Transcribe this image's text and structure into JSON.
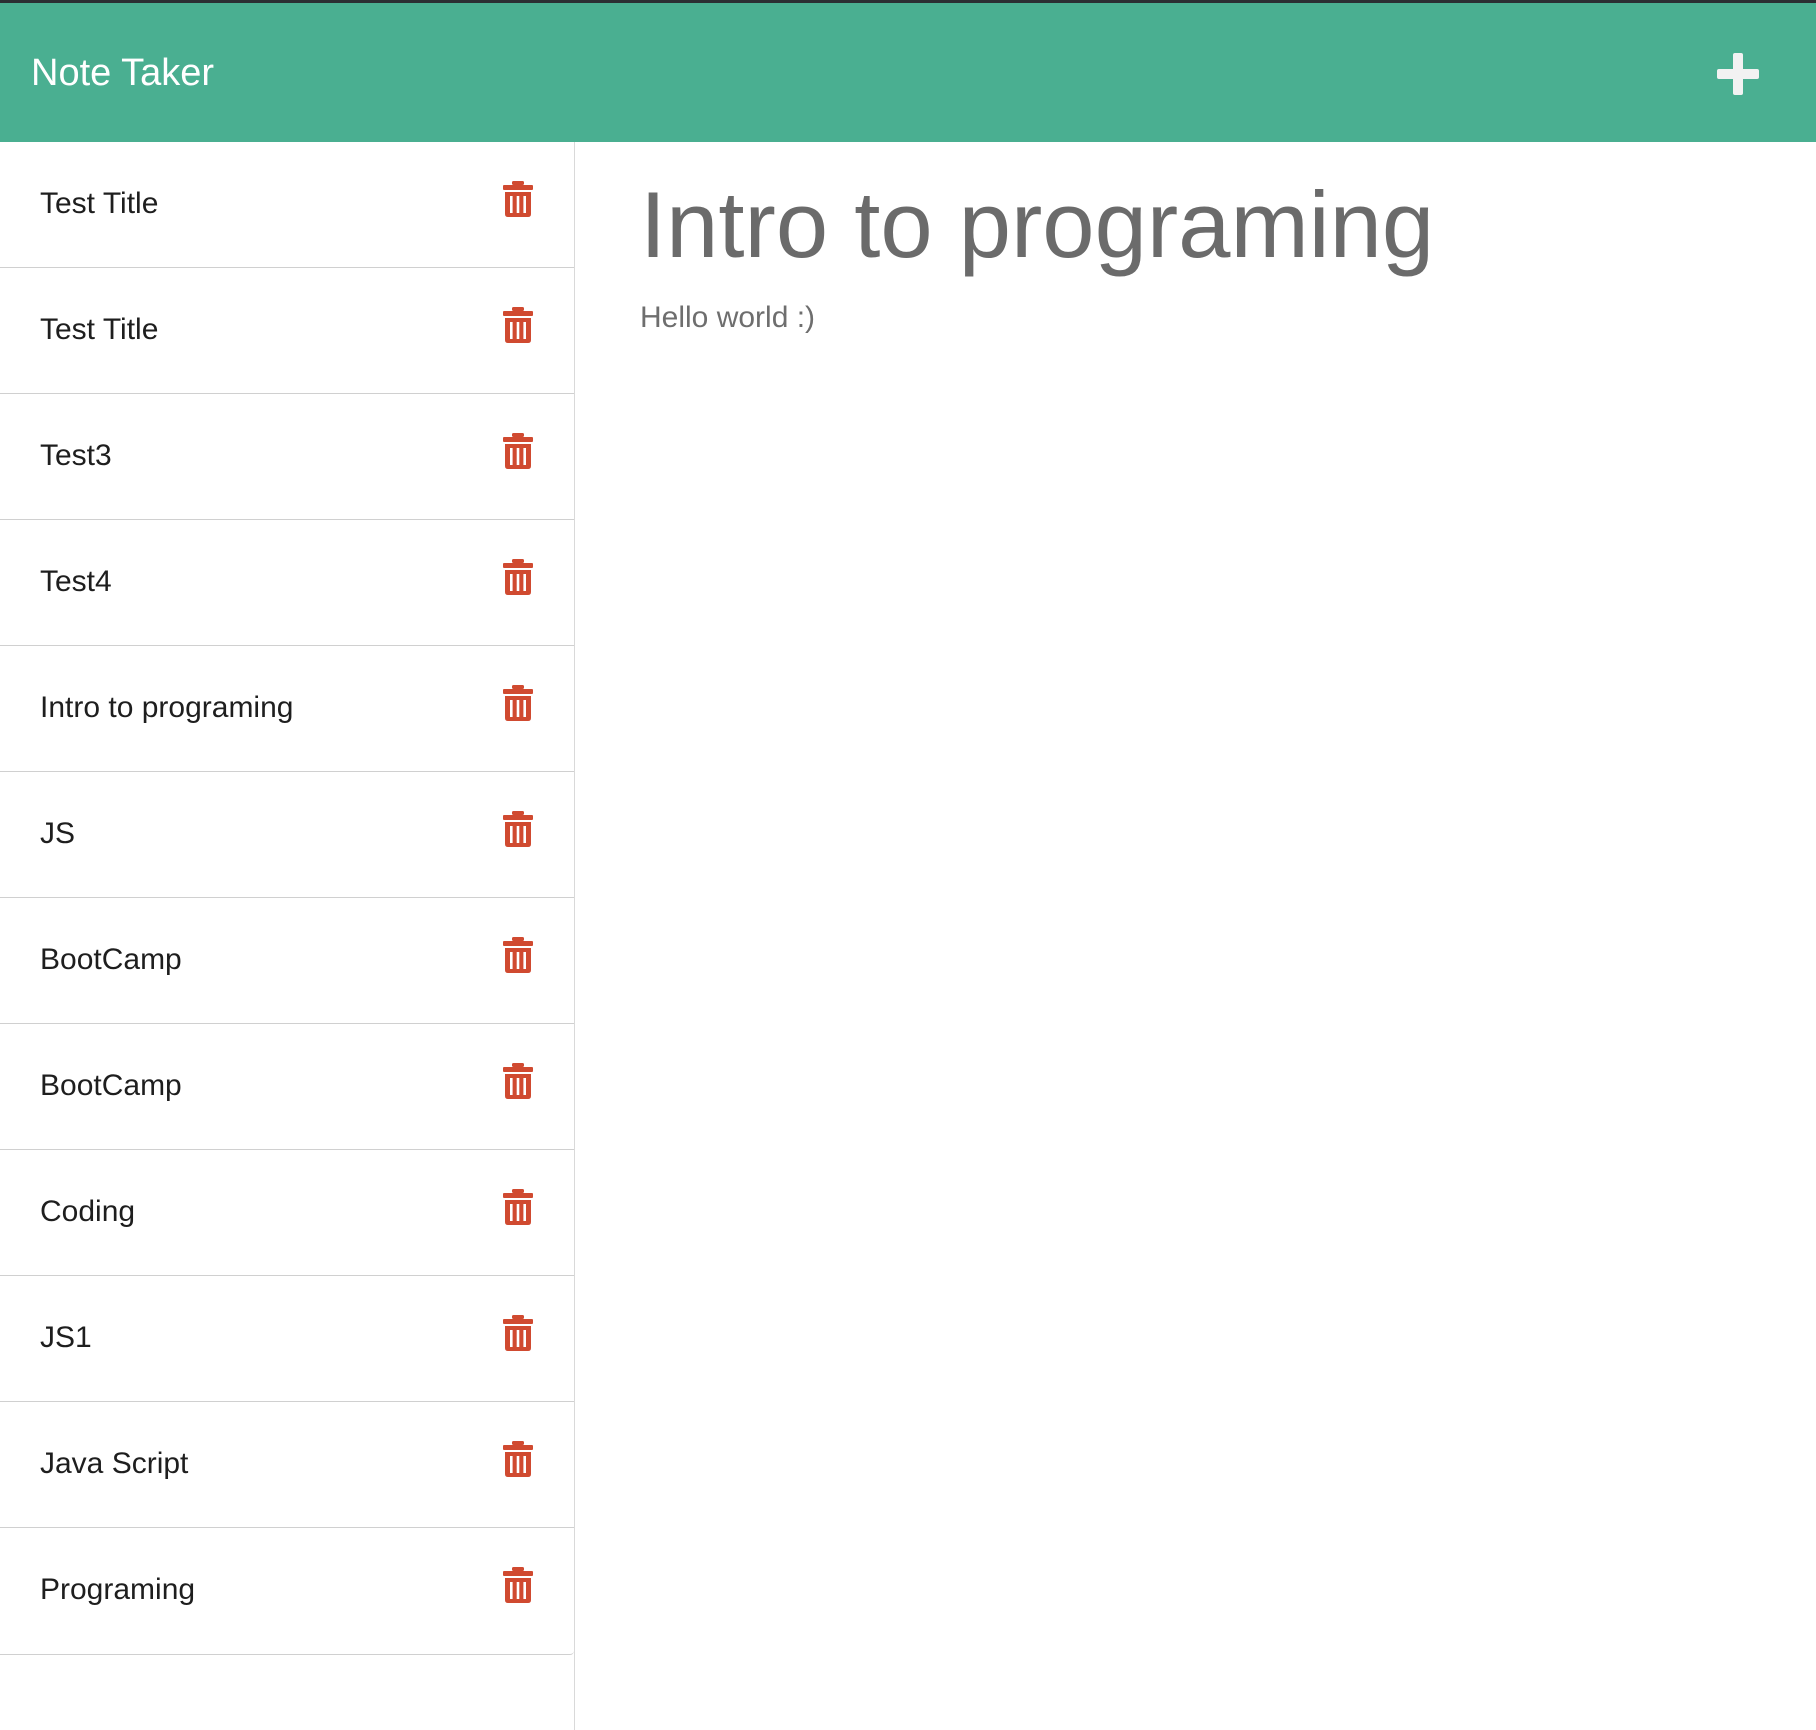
{
  "app": {
    "title": "Note Taker",
    "brand_color": "#4aaf91",
    "delete_icon_color": "#d04a30"
  },
  "navbar": {
    "brand": "Note Taker",
    "new_note_icon": "plus-icon"
  },
  "sidebar": {
    "notes": [
      {
        "title": "Test Title",
        "delete_icon": "trash-icon"
      },
      {
        "title": "Test Title",
        "delete_icon": "trash-icon"
      },
      {
        "title": "Test3",
        "delete_icon": "trash-icon"
      },
      {
        "title": "Test4",
        "delete_icon": "trash-icon"
      },
      {
        "title": "Intro to programing",
        "delete_icon": "trash-icon"
      },
      {
        "title": "JS",
        "delete_icon": "trash-icon"
      },
      {
        "title": "BootCamp",
        "delete_icon": "trash-icon"
      },
      {
        "title": "BootCamp",
        "delete_icon": "trash-icon"
      },
      {
        "title": "Coding",
        "delete_icon": "trash-icon"
      },
      {
        "title": "JS1",
        "delete_icon": "trash-icon"
      },
      {
        "title": "Java Script",
        "delete_icon": "trash-icon"
      },
      {
        "title": "Programing",
        "delete_icon": "trash-icon"
      }
    ]
  },
  "main": {
    "note_title": "Intro to programing",
    "note_text": "Hello world :)"
  }
}
